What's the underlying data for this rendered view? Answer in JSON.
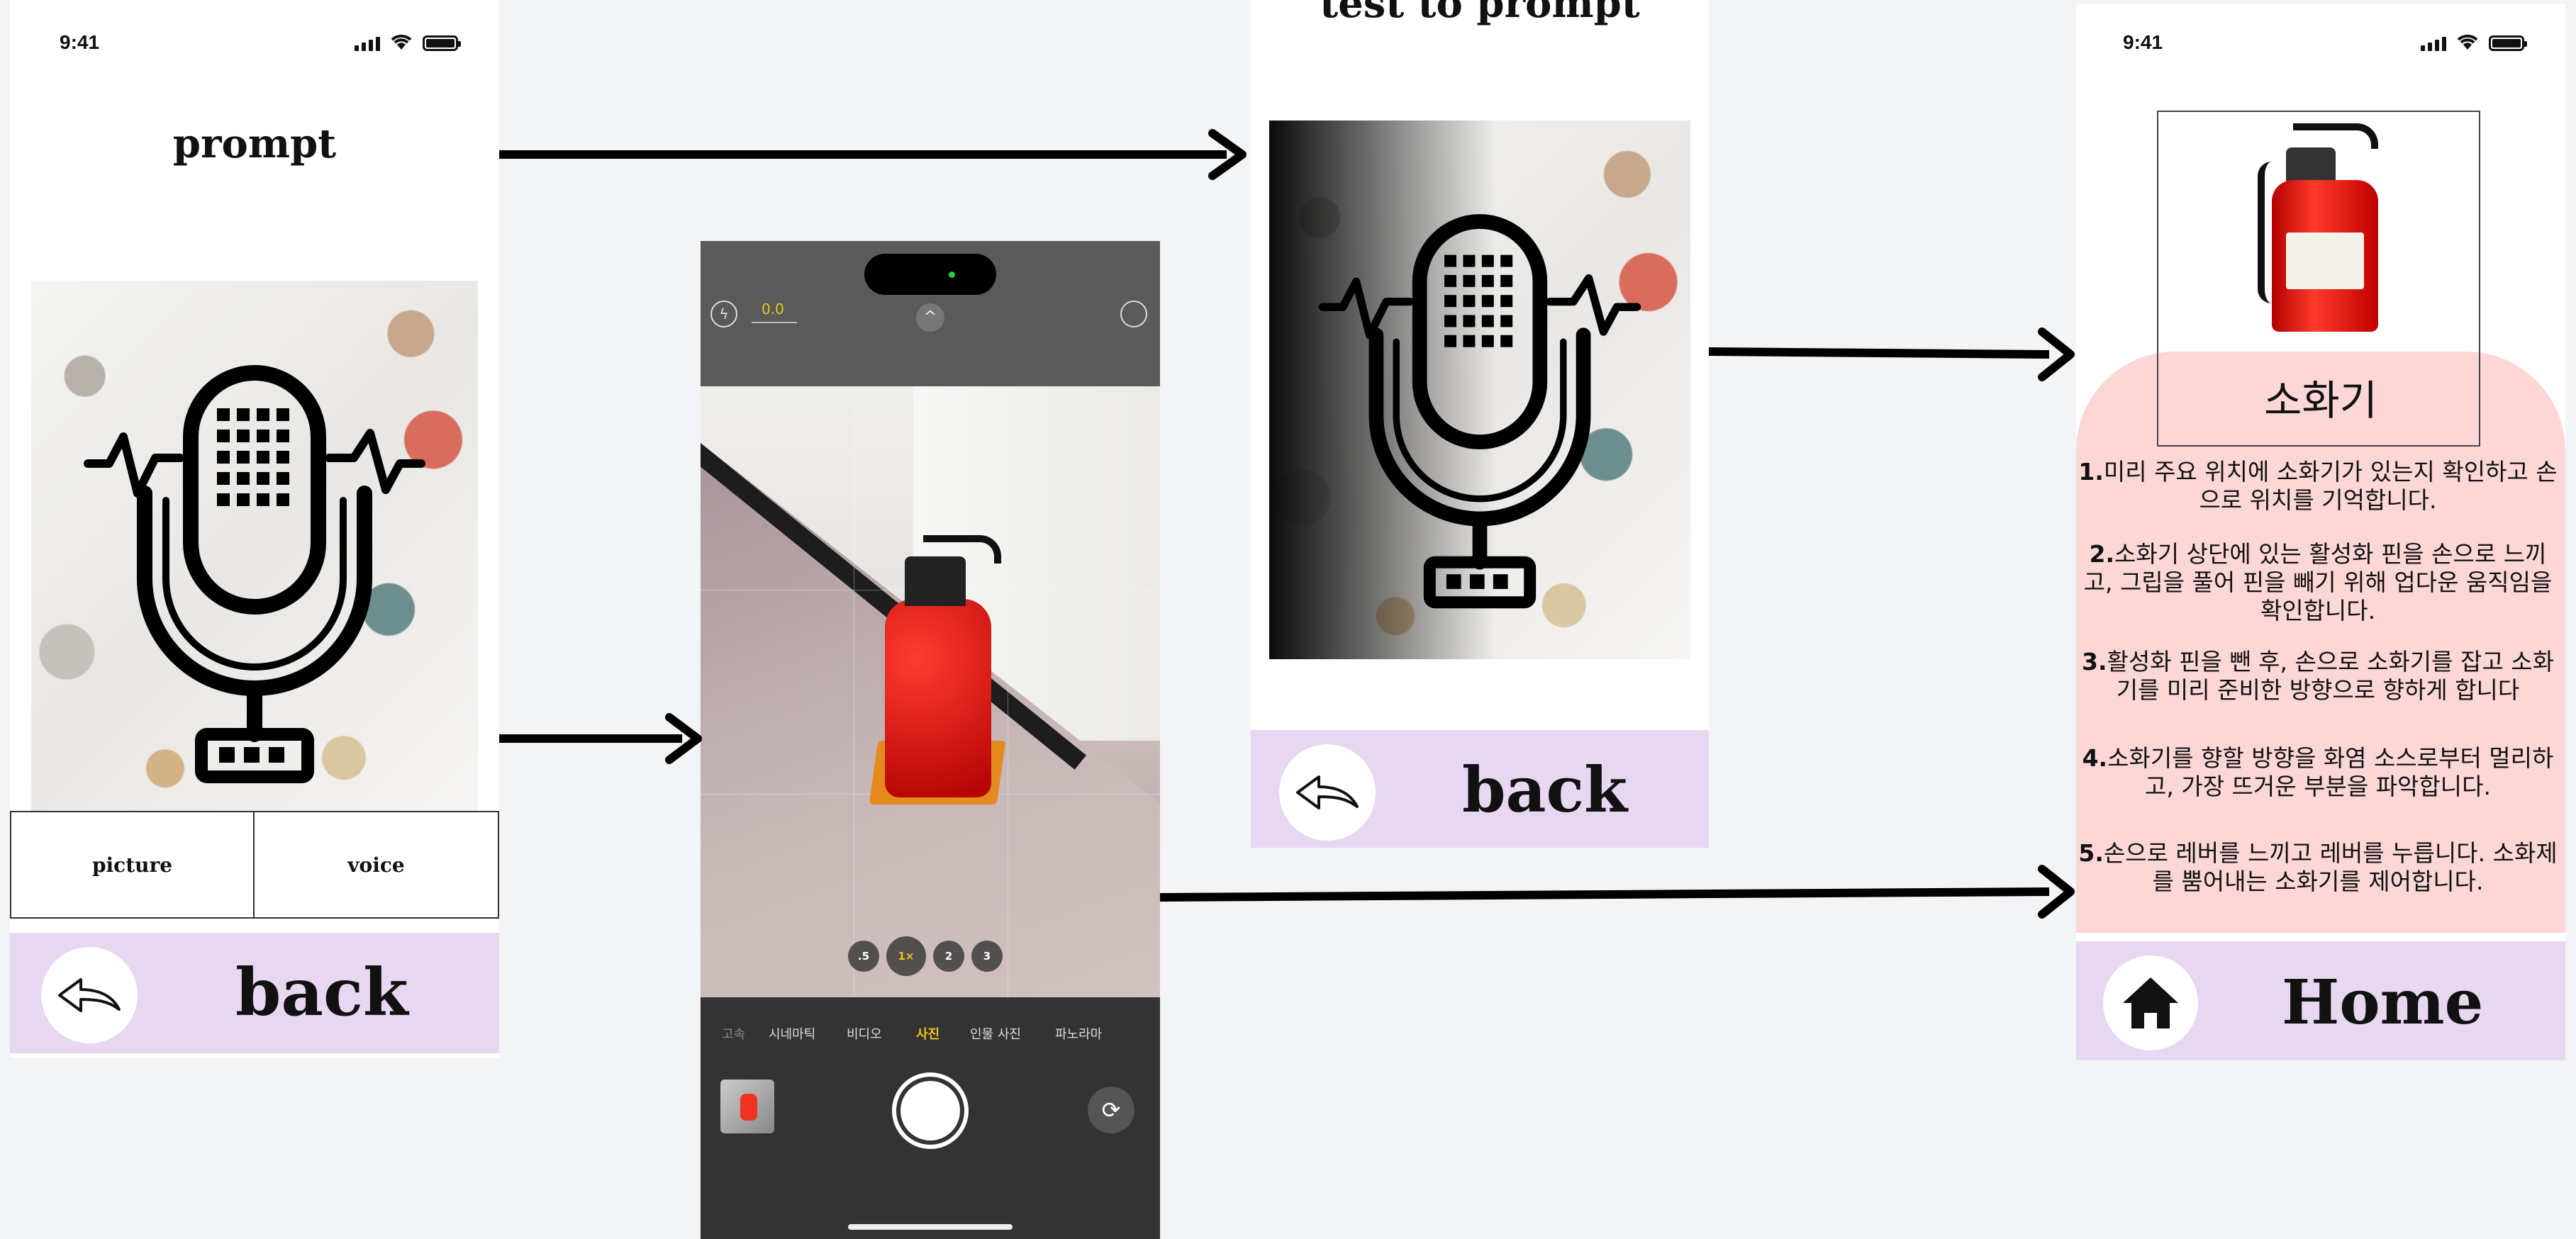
{
  "screen1": {
    "status_time": "9:41",
    "title": "prompt",
    "tabs": [
      {
        "label": "picture"
      },
      {
        "label": "voice"
      }
    ],
    "back_label": "back"
  },
  "camera": {
    "zoom_readout": "0.0",
    "modes": [
      "고속",
      "시네마틱",
      "비디오",
      "사진",
      "인물 사진",
      "파노라마"
    ],
    "active_mode": "사진",
    "zoom_levels": [
      ".5",
      "1×",
      "2",
      "3"
    ],
    "active_zoom": "1×"
  },
  "screen3": {
    "title": "test to prompt",
    "back_label": "back"
  },
  "screen4": {
    "status_time": "9:41",
    "object_label": "소화기",
    "steps": [
      {
        "num": "1.",
        "text": "미리 주요 위치에 소화기가 있는지 확인하고 손으로 위치를 기억합니다."
      },
      {
        "num": "2.",
        "text": "소화기 상단에 있는 활성화 핀을 손으로 느끼고, 그립을 풀어 핀을 빼기 위해 업다운 움직임을 확인합니다."
      },
      {
        "num": "3.",
        "text": "활성화 핀을 뺀 후, 손으로 소화기를 잡고 소화기를 미리 준비한 방향으로 향하게 합니다"
      },
      {
        "num": "4.",
        "text": "소화기를 향할 방향을 화염 소스로부터 멀리하고, 가장 뜨거운 부분을 파악합니다."
      },
      {
        "num": "5.",
        "text": "손으로 레버를 느끼고 레버를 누릅니다. 소화제를 뿜어내는 소화기를 제어합니다."
      }
    ],
    "home_label": "Home"
  },
  "colors": {
    "back_bar": "#e7d7f1",
    "result_card": "#fdd6d6",
    "canvas": "#f3f4f6"
  },
  "icons": [
    "signal-icon",
    "wifi-icon",
    "battery-icon",
    "microphone-icon",
    "reply-arrow-icon",
    "home-icon",
    "flash-off-icon",
    "live-off-icon",
    "shutter-button",
    "flip-camera-icon",
    "fire-extinguisher-image"
  ]
}
